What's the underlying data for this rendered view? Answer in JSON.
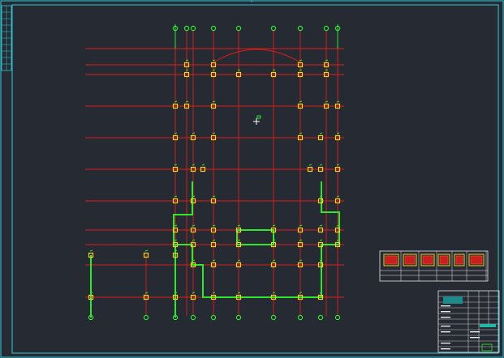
{
  "drawing": {
    "background": "#252a33",
    "frame_color": "#35c8d8",
    "axis_color": "#e01c1c",
    "wall_color": "#2ee82e",
    "column_color": "#f2d21a",
    "bubble_color": "#2ee82e",
    "title_block_color": "#e8e8e8"
  },
  "icons": {
    "cursor": "crosshair-cursor-icon",
    "column": "column-marker-icon",
    "axis_bubble": "axis-bubble-icon"
  }
}
